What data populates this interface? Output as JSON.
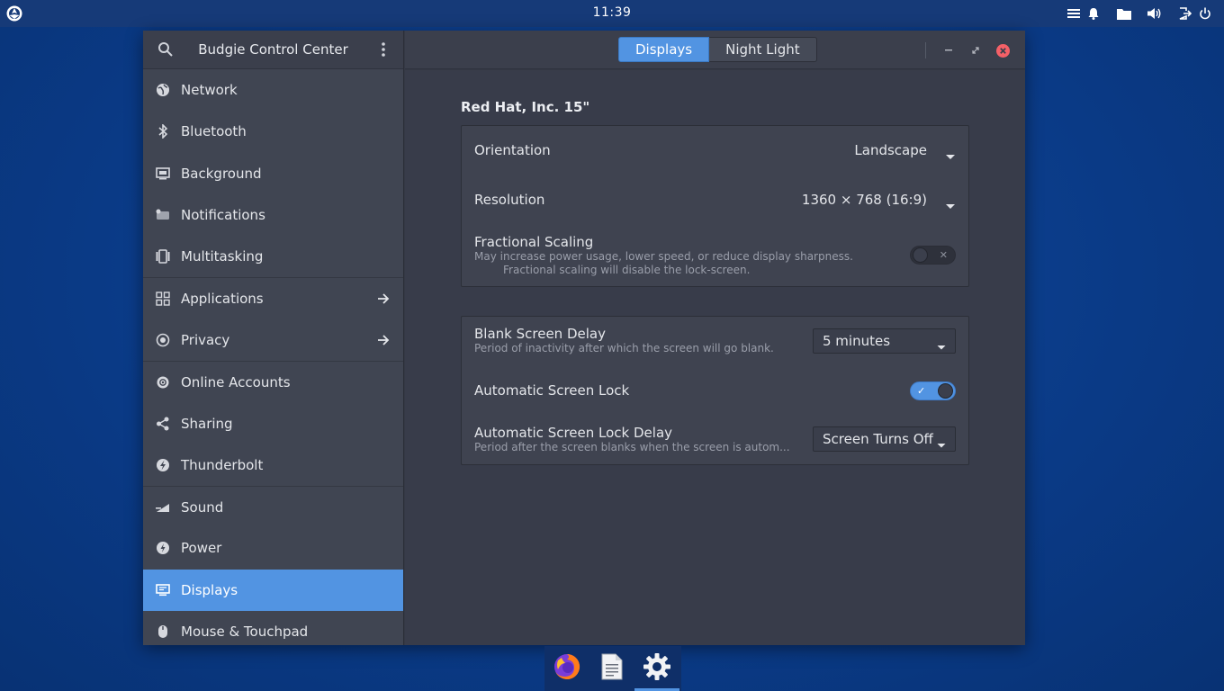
{
  "panel": {
    "clock": "11:39"
  },
  "sidebar": {
    "title": "Budgie Control Center",
    "items": [
      {
        "label": "Network",
        "icon": "network-icon"
      },
      {
        "label": "Bluetooth",
        "icon": "bluetooth-icon"
      },
      {
        "label": "Background",
        "icon": "background-icon"
      },
      {
        "label": "Notifications",
        "icon": "notifications-icon"
      },
      {
        "label": "Multitasking",
        "icon": "multitasking-icon"
      },
      {
        "label": "Applications",
        "icon": "applications-icon",
        "has_arrow": true
      },
      {
        "label": "Privacy",
        "icon": "privacy-icon",
        "has_arrow": true
      },
      {
        "label": "Online Accounts",
        "icon": "online-accounts-icon"
      },
      {
        "label": "Sharing",
        "icon": "sharing-icon"
      },
      {
        "label": "Thunderbolt",
        "icon": "thunderbolt-icon"
      },
      {
        "label": "Sound",
        "icon": "sound-icon"
      },
      {
        "label": "Power",
        "icon": "power-icon"
      },
      {
        "label": "Displays",
        "icon": "displays-icon",
        "active": true
      },
      {
        "label": "Mouse & Touchpad",
        "icon": "mouse-icon"
      }
    ]
  },
  "header": {
    "tabs": [
      {
        "label": "Displays",
        "active": true
      },
      {
        "label": "Night Light",
        "active": false
      }
    ]
  },
  "main": {
    "monitor_title": "Red Hat, Inc. 15\"",
    "orientation": {
      "label": "Orientation",
      "value": "Landscape"
    },
    "resolution": {
      "label": "Resolution",
      "value": "1360 × 768 (16:9)"
    },
    "fractional_scaling": {
      "label": "Fractional Scaling",
      "subtitle_line1": "May increase power usage, lower speed, or reduce display sharpness.",
      "subtitle_line2": "Fractional scaling will disable the lock-screen.",
      "enabled": false
    },
    "blank_screen_delay": {
      "label": "Blank Screen Delay",
      "subtitle": "Period of inactivity after which the screen will go blank.",
      "value": "5 minutes"
    },
    "auto_lock": {
      "label": "Automatic Screen Lock",
      "enabled": true
    },
    "auto_lock_delay": {
      "label": "Automatic Screen Lock Delay",
      "subtitle": "Period after the screen blanks when the screen is autom...",
      "value": "Screen Turns Off"
    }
  },
  "dock": {
    "items": [
      "firefox-icon",
      "text-editor-icon",
      "settings-icon"
    ],
    "active": "settings-icon"
  },
  "colors": {
    "accent": "#5294e2",
    "close": "#f46067",
    "desktop": "#0a3a86"
  }
}
